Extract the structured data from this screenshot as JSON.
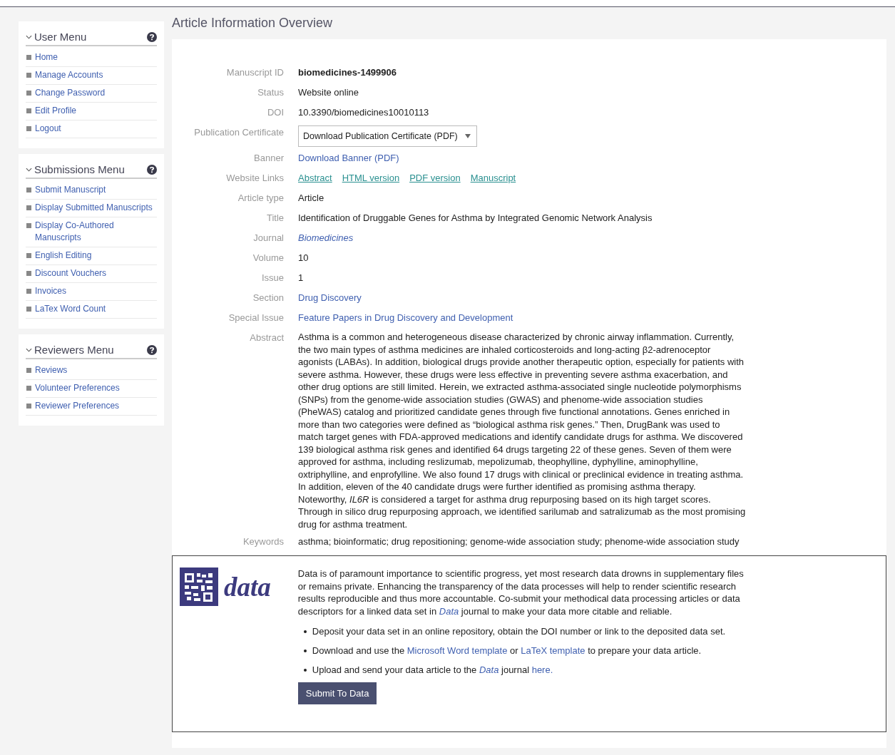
{
  "menus": [
    {
      "title": "User Menu",
      "expanded": true,
      "items": [
        "Home",
        "Manage Accounts",
        "Change Password",
        "Edit Profile",
        "Logout"
      ]
    },
    {
      "title": "Submissions Menu",
      "expanded": true,
      "items": [
        "Submit Manuscript",
        "Display Submitted Manuscripts",
        "Display Co-Authored Manuscripts",
        "English Editing",
        "Discount Vouchers",
        "Invoices",
        "LaTex Word Count"
      ]
    },
    {
      "title": "Reviewers Menu",
      "expanded": true,
      "items": [
        "Reviews",
        "Volunteer Preferences",
        "Reviewer Preferences"
      ]
    }
  ],
  "page_title": "Article Information Overview",
  "fields": [
    {
      "label": "Manuscript ID",
      "kind": "bold",
      "value": "biomedicines-1499906"
    },
    {
      "label": "Status",
      "kind": "text",
      "value": "Website online"
    },
    {
      "label": "DOI",
      "kind": "text",
      "value": "10.3390/biomedicines10010113"
    },
    {
      "label": "Publication Certificate",
      "kind": "select",
      "value": "Download Publication Certificate (PDF)"
    },
    {
      "label": "Banner",
      "kind": "link",
      "value": "Download Banner (PDF)"
    },
    {
      "label": "Website Links",
      "kind": "links",
      "values": [
        "Abstract",
        "HTML version",
        "PDF version",
        "Manuscript"
      ]
    },
    {
      "label": "Article type",
      "kind": "text",
      "value": "Article"
    },
    {
      "label": "Title",
      "kind": "text",
      "value": "Identification of Druggable Genes for Asthma by Integrated Genomic Network Analysis"
    },
    {
      "label": "Journal",
      "kind": "italic_link",
      "value": "Biomedicines"
    },
    {
      "label": "Volume",
      "kind": "text",
      "value": "10"
    },
    {
      "label": "Issue",
      "kind": "text",
      "value": "1"
    },
    {
      "label": "Section",
      "kind": "link",
      "value": "Drug Discovery"
    },
    {
      "label": "Special Issue",
      "kind": "link",
      "value": "Feature Papers in Drug Discovery and Development"
    },
    {
      "label": "Abstract",
      "kind": "paragraph",
      "value": "Asthma is a common and heterogeneous disease characterized by chronic airway inflammation. Currently, the two main types of asthma medicines are inhaled corticosteroids and long-acting β2-adrenoceptor agonists (LABAs). In addition, biological drugs provide another therapeutic option, especially for patients with severe asthma. However, these drugs were less effective in preventing severe asthma exacerbation, and other drug options are still limited. Herein, we extracted asthma-associated single nucleotide polymorphisms (SNPs) from the genome-wide association studies (GWAS) and phenome-wide association studies (PheWAS) catalog and prioritized candidate genes through five functional annotations. Genes enriched in more than two categories were defined as “biological asthma risk genes.” Then, DrugBank was used to match target genes with FDA-approved medications and identify candidate drugs for asthma. We discovered 139 biological asthma risk genes and identified 64 drugs targeting 22 of these genes. Seven of them were approved for asthma, including reslizumab, mepolizumab, theophylline, dyphylline, aminophylline, oxtriphylline, and enprofylline. We also found 17 drugs with clinical or preclinical evidence in treating asthma. In addition, eleven of the 40 candidate drugs were further identified as promising asthma therapy. Noteworthy, *IL6R* is considered a target for asthma drug repurposing based on its high target scores. Through in silico drug repurposing approach, we identified sarilumab and satralizumab as the most promising drug for asthma treatment."
    },
    {
      "label": "Keywords",
      "kind": "text",
      "value": "asthma; bioinformatic; drug repositioning; genome-wide association study; phenome-wide association study"
    }
  ],
  "data_box": {
    "logo_text": "data",
    "intro": [
      {
        "kind": "text",
        "text": "Data is of paramount importance to scientific progress, yet most research data drowns in supplementary files or remains private. Enhancing the transparency of the data processes will help to render scientific research results reproducible and thus more accountable. Co-submit your methodical data processing articles or data descriptors for a linked data set in "
      },
      {
        "kind": "link",
        "text": "Data"
      },
      {
        "kind": "text",
        "text": " journal to make your data more citable and reliable."
      }
    ],
    "bullets": [
      [
        {
          "kind": "text",
          "text": "Deposit your data set in an online repository, obtain the DOI number or link to the deposited data set."
        }
      ],
      [
        {
          "kind": "text",
          "text": "Download and use the "
        },
        {
          "kind": "link",
          "text": "Microsoft Word template"
        },
        {
          "kind": "text",
          "text": " or "
        },
        {
          "kind": "link",
          "text": "LaTeX template"
        },
        {
          "kind": "text",
          "text": " to prepare your data article."
        }
      ],
      [
        {
          "kind": "text",
          "text": "Upload and send your data article to the "
        },
        {
          "kind": "link",
          "text": "Data"
        },
        {
          "kind": "text",
          "text": " journal "
        },
        {
          "kind": "link",
          "text": "here."
        }
      ]
    ],
    "button": "Submit To Data"
  }
}
